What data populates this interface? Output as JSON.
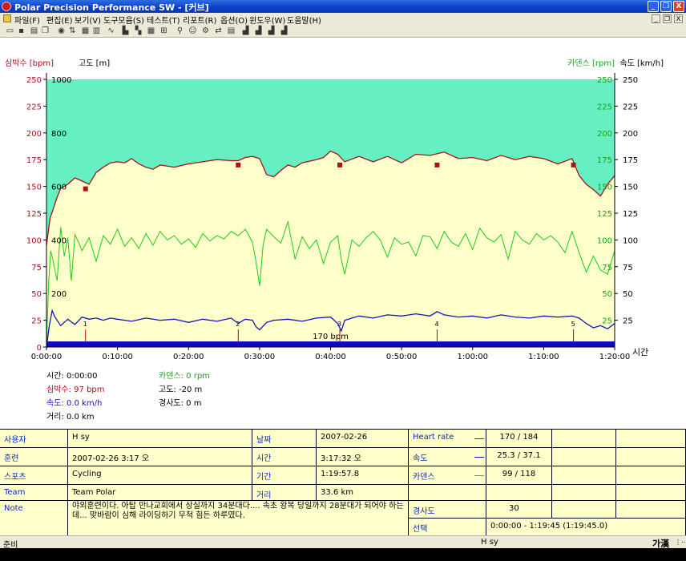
{
  "window": {
    "title": "Polar Precision Performance SW - [커브]",
    "controls": {
      "minimize": "_",
      "restore": "❐",
      "close": "X"
    }
  },
  "menu": {
    "items": [
      "파일(F)",
      "편집(E)",
      "보기(V)",
      "도구모음(S)",
      "테스트(T)",
      "리포트(R)",
      "옵션(O)",
      "윈도우(W)",
      "도움말(H)"
    ],
    "mdi_controls": {
      "minimize": "_",
      "restore": "❐",
      "close": "X"
    }
  },
  "toolbar": {
    "icons": [
      "open-icon",
      "save-icon",
      "print-icon",
      "copy-icon",
      "sports-zones-icon",
      "transfer-icon",
      "calendar-icon",
      "book-icon",
      "curve-icon",
      "bar-chart-icon",
      "table-icon",
      "grid-icon",
      "zoom-icon",
      "search-icon",
      "person-icon",
      "settings-icon",
      "export-icon",
      "report-icon",
      "report-week-icon",
      "report-month-icon",
      "report-year-icon",
      "report-total-icon"
    ]
  },
  "chart": {
    "hr_axis_title": "심박수 [bpm]",
    "alt_axis_title": "고도 [m]",
    "cad_axis_title": "카덴스 [rpm]",
    "speed_axis_title": "속도 [km/h]",
    "time_axis_title": "시간",
    "avg_label": "170 bpm",
    "lap_marks": [
      "1",
      "2",
      "3",
      "4",
      "5"
    ],
    "colors": {
      "plot_bg": "#ffffcc",
      "altitude_fill": "#66efc2",
      "heart_rate": "#a8101c",
      "cadence": "#18cc18",
      "speed": "#1414b4",
      "time_bar": "#0a0ac8",
      "left_axis_text": "#a8101c",
      "right_axis_text": "#18a018"
    }
  },
  "chart_data": {
    "type": "line",
    "title": "",
    "xlabel": "시간",
    "x_ticks": [
      "0:00:00",
      "0:10:00",
      "0:20:00",
      "0:30:00",
      "0:40:00",
      "0:50:00",
      "1:00:00",
      "1:10:00",
      "1:20:00"
    ],
    "xlim_minutes": [
      0,
      80
    ],
    "hr_ticks": [
      "0",
      "25",
      "50",
      "75",
      "100",
      "125",
      "150",
      "175",
      "200",
      "225",
      "250"
    ],
    "hr_ylim": [
      0,
      250
    ],
    "alt_ticks": [
      "200",
      "400",
      "600",
      "800",
      "1000"
    ],
    "cad_ticks": [
      "25",
      "50",
      "75",
      "100",
      "125",
      "150",
      "175",
      "200",
      "225",
      "250"
    ],
    "speed_ticks": [
      "25",
      "50",
      "75",
      "100",
      "125",
      "150",
      "175",
      "200",
      "225",
      "250"
    ],
    "grid": false,
    "series": [
      {
        "name": "심박수 [bpm]",
        "color": "#a8101c",
        "minutes": [
          0,
          0.5,
          1,
          1.5,
          2,
          3,
          4,
          5,
          6,
          7,
          8,
          9,
          10,
          11,
          12,
          13,
          14,
          15,
          16,
          18,
          20,
          22,
          24,
          26,
          27,
          28,
          29,
          30,
          31,
          32,
          33,
          34,
          35,
          36,
          38,
          39,
          40,
          41,
          42,
          44,
          46,
          48,
          50,
          52,
          54,
          56,
          58,
          60,
          62,
          64,
          66,
          68,
          70,
          72,
          74,
          75,
          76,
          77,
          78,
          79,
          80
        ],
        "values": [
          95,
          120,
          130,
          140,
          148,
          152,
          158,
          155,
          152,
          163,
          168,
          172,
          173,
          172,
          176,
          171,
          168,
          166,
          170,
          168,
          171,
          173,
          175,
          174,
          174,
          177,
          178,
          176,
          161,
          159,
          165,
          170,
          168,
          172,
          175,
          177,
          183,
          180,
          173,
          178,
          173,
          178,
          172,
          180,
          179,
          182,
          176,
          177,
          174,
          179,
          175,
          178,
          176,
          171,
          176,
          160,
          152,
          147,
          141,
          152,
          160
        ]
      },
      {
        "name": "카덴스 [rpm]",
        "color": "#18cc18",
        "minutes": [
          0,
          0.3,
          0.6,
          1,
          1.5,
          2,
          2.5,
          3,
          3.5,
          4,
          4.5,
          5,
          6,
          7,
          8,
          9,
          10,
          11,
          12,
          13,
          14,
          15,
          16,
          17,
          18,
          19,
          20,
          21,
          22,
          23,
          24,
          25,
          26,
          27,
          28,
          29,
          29.5,
          30,
          30.5,
          31,
          32,
          33,
          34,
          35,
          36,
          37,
          38,
          39,
          40,
          41,
          41.5,
          42,
          43,
          44,
          45,
          46,
          47,
          48,
          49,
          50,
          51,
          52,
          53,
          54,
          55,
          56,
          57,
          58,
          59,
          60,
          61,
          62,
          63,
          64,
          65,
          66,
          67,
          68,
          69,
          70,
          71,
          72,
          73,
          74,
          75,
          76,
          77,
          78,
          79,
          80
        ],
        "values": [
          0,
          60,
          90,
          78,
          62,
          112,
          85,
          102,
          62,
          105,
          98,
          90,
          102,
          80,
          104,
          96,
          110,
          94,
          102,
          92,
          106,
          95,
          108,
          100,
          104,
          96,
          101,
          93,
          106,
          99,
          104,
          101,
          108,
          104,
          110,
          98,
          80,
          57,
          95,
          110,
          103,
          97,
          117,
          82,
          103,
          92,
          100,
          78,
          98,
          104,
          82,
          68,
          100,
          94,
          102,
          108,
          100,
          84,
          102,
          96,
          98,
          85,
          104,
          103,
          92,
          108,
          98,
          94,
          106,
          91,
          111,
          102,
          98,
          105,
          82,
          108,
          100,
          96,
          106,
          100,
          104,
          98,
          88,
          108,
          88,
          70,
          85,
          72,
          68,
          90,
          92
        ]
      },
      {
        "name": "속도 [km/h]",
        "color": "#1414b4",
        "minutes": [
          0,
          0.4,
          0.8,
          1.2,
          2,
          3,
          4,
          5,
          6,
          7,
          8,
          9,
          10,
          12,
          14,
          16,
          18,
          20,
          22,
          24,
          26,
          27,
          28,
          29,
          29.5,
          30,
          31,
          32,
          34,
          36,
          38,
          40,
          41,
          41.5,
          42,
          44,
          46,
          48,
          50,
          52,
          54,
          55,
          56,
          58,
          60,
          62,
          64,
          66,
          68,
          70,
          72,
          74,
          75,
          76,
          77,
          78,
          79,
          80
        ],
        "values": [
          0,
          20,
          34,
          28,
          20,
          26,
          21,
          28,
          26,
          27,
          25,
          27,
          26,
          24,
          27,
          25,
          26,
          23,
          26,
          24,
          27,
          22,
          26,
          25,
          19,
          16,
          23,
          25,
          26,
          24,
          27,
          28,
          22,
          15,
          25,
          29,
          27,
          30,
          29,
          31,
          29,
          33,
          30,
          28,
          29,
          27,
          30,
          28,
          27,
          29,
          28,
          29,
          27,
          22,
          18,
          20,
          17,
          22,
          18
        ]
      },
      {
        "name": "고도 [m]",
        "color": "#66efc2",
        "minutes": [
          0,
          80
        ],
        "values": [
          -20,
          -20
        ]
      }
    ]
  },
  "readout": {
    "time_label": "시간:",
    "time_value": "0:00:00",
    "hr_label": "심박수:",
    "hr_value": "97 bpm",
    "speed_label": "속도:",
    "speed_value": "0.0 km/h",
    "distance_label": "거리:",
    "distance_value": "0.0 km",
    "cadence_label": "카덴스:",
    "cadence_value": "0 rpm",
    "altitude_label": "고도:",
    "altitude_value": "-20 m",
    "incline_label": "경사도:",
    "incline_value": "0 m"
  },
  "info": {
    "user_label": "사용자",
    "user_value": "H sy",
    "training_label": "훈련",
    "training_value": "2007-02-26 3:17 오",
    "sport_label": "스포츠",
    "sport_value": "Cycling",
    "team_label": "Team",
    "team_value": "Team Polar",
    "note_label": "Note",
    "note_value": "야외훈련이다. 아탑 만나교회에서 상실까지 34분대다.... 속초 왕복 당일까지 28분대가 되어야 하는데... 맞바람이 심해 라이딩하기 무척 힘든 하루였다.",
    "date_label": "날짜",
    "date_value": "2007-02-26",
    "time_label": "시간",
    "time_value": "3:17:32 오",
    "duration_label": "기간",
    "duration_value": "1:19:57.8",
    "distance_label": "거리",
    "distance_value": "33.6 km",
    "hr_label": "Heart rate",
    "hr_value": "170 / 184",
    "speed_label": "속도",
    "speed_value": "25.3 / 37.1",
    "cadence_label": "카덴스",
    "cadence_value": "99 / 118",
    "incline_label": "경사도",
    "incline_value": "30",
    "selection_label": "선택",
    "selection_value": "0:00:00 - 1:19:45 (1:19:45.0)"
  },
  "status": {
    "left": "준비",
    "user": "H sy",
    "ime": "가漢",
    "ime_extra": "⋮⋯"
  }
}
